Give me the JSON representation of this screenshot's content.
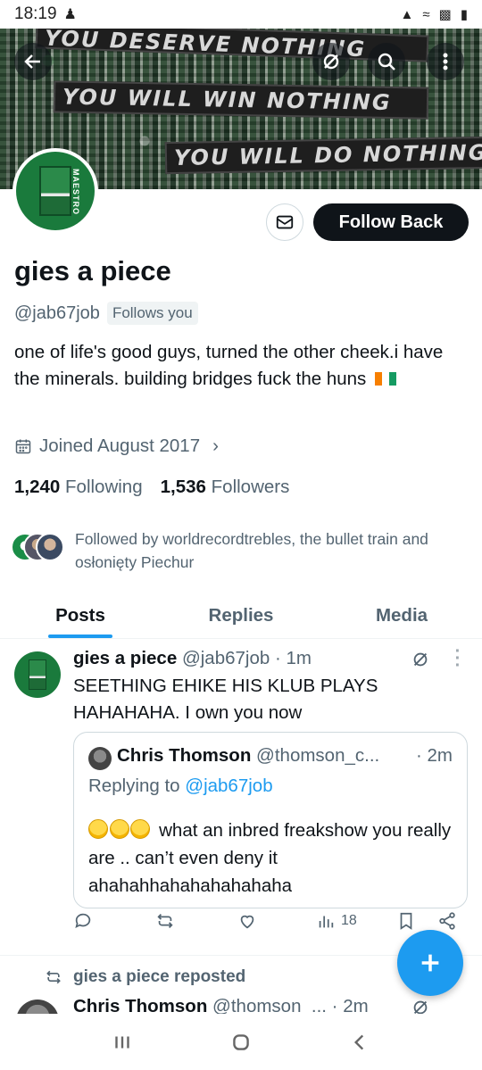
{
  "status_bar": {
    "time": "18:19"
  },
  "banner": {
    "flag_texts": [
      "YOU DESERVE NOTHING",
      "YOU WILL WIN NOTHING",
      "YOU WILL DO NOTHING"
    ]
  },
  "avatar": {
    "label": "MAESTRO"
  },
  "profile": {
    "name": "gies a piece",
    "handle": "@jab67job",
    "follows_you": "Follows you",
    "bio": "one of life's good guys, turned the other cheek.i have the minerals. building bridges   fuck the huns",
    "joined": "Joined August 2017",
    "following_count": "1,240",
    "following_label": "Following",
    "followers_count": "1,536",
    "followers_label": "Followers",
    "followed_by": "Followed by worldrecordtrebles, the bullet train and osłonięty Piechur"
  },
  "actions": {
    "follow_back": "Follow Back"
  },
  "tabs": [
    {
      "label": "Posts",
      "active": true
    },
    {
      "label": "Replies",
      "active": false
    },
    {
      "label": "Media",
      "active": false
    }
  ],
  "tweet": {
    "name": "gies a piece",
    "handle_time": "@jab67job · 1m",
    "text": "SEETHING EHIKE HIS KLUB PLAYS HAHAHAHA. I own you now",
    "quote": {
      "name": "Chris Thomson",
      "handle": "@thomson_c...",
      "time": "· 2m",
      "replying_prefix": "Replying to ",
      "replying_to": "@jab67job",
      "text": "what an inbred freakshow you really are .. can’t even deny it ahahahhahahahahahaha"
    },
    "views": "18"
  },
  "repost_row": {
    "label": "gies a piece reposted"
  },
  "next_tweet": {
    "name": "Chris Thomson",
    "handle_time": "@thomson_... · 2m"
  },
  "colors": {
    "accent": "#1d9bf0",
    "text": "#0f1419",
    "muted": "#536471"
  }
}
